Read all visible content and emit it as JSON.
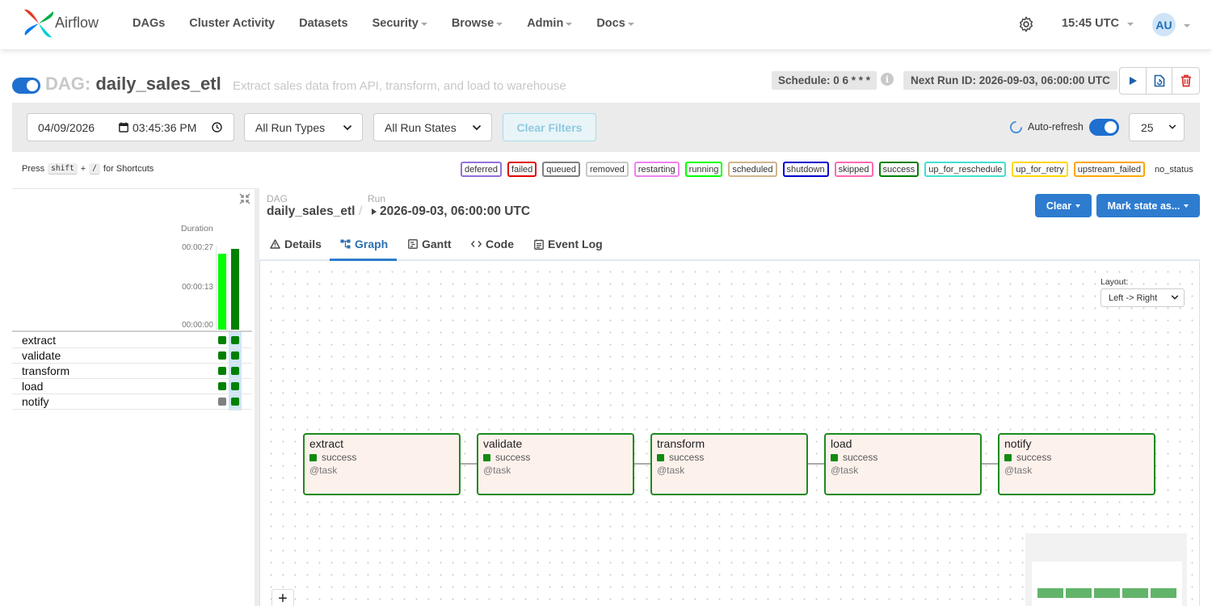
{
  "nav": {
    "brand": "Airflow",
    "items": [
      {
        "label": "DAGs",
        "dropdown": false
      },
      {
        "label": "Cluster Activity",
        "dropdown": false
      },
      {
        "label": "Datasets",
        "dropdown": false
      },
      {
        "label": "Security",
        "dropdown": true
      },
      {
        "label": "Browse",
        "dropdown": true
      },
      {
        "label": "Admin",
        "dropdown": true
      },
      {
        "label": "Docs",
        "dropdown": true
      }
    ],
    "time": "15:45 UTC",
    "user_initials": "AU"
  },
  "dag": {
    "prefix": "DAG:",
    "id": "daily_sales_etl",
    "description": "Extract sales data from API, transform, and load to warehouse",
    "schedule": "Schedule: 0 6 * * *",
    "next_run": "Next Run ID: 2026-09-03, 06:00:00 UTC"
  },
  "filters": {
    "date": "04/09/2026",
    "time": "03:45:36 PM",
    "run_type": "All Run Types",
    "run_state": "All Run States",
    "clear_filters": "Clear Filters",
    "auto_refresh": "Auto-refresh",
    "count": "25"
  },
  "shortcuts": {
    "press": "Press",
    "key1": "shift",
    "plus": "+",
    "key2": "/",
    "suffix": "for Shortcuts"
  },
  "legend": [
    {
      "label": "deferred",
      "color": "#9370db"
    },
    {
      "label": "failed",
      "color": "#e00000"
    },
    {
      "label": "queued",
      "color": "#808080"
    },
    {
      "label": "removed",
      "color": "#c8c8c8"
    },
    {
      "label": "restarting",
      "color": "#ee82ee"
    },
    {
      "label": "running",
      "color": "#00ff00"
    },
    {
      "label": "scheduled",
      "color": "#d2b48c"
    },
    {
      "label": "shutdown",
      "color": "#0000cd"
    },
    {
      "label": "skipped",
      "color": "#ff69b4"
    },
    {
      "label": "success",
      "color": "#008000"
    },
    {
      "label": "up_for_reschedule",
      "color": "#40e0d0"
    },
    {
      "label": "up_for_retry",
      "color": "#ffd700"
    },
    {
      "label": "upstream_failed",
      "color": "#ffa500"
    },
    {
      "label": "no_status",
      "color": ""
    }
  ],
  "grid": {
    "duration_label": "Duration",
    "ticks": [
      "00:00:27",
      "00:00:13",
      "00:00:00"
    ],
    "runs": [
      {
        "duration_fraction": 0.92,
        "color": "#00ff00"
      },
      {
        "duration_fraction": 0.98,
        "color": "#008000"
      }
    ],
    "tasks": [
      {
        "name": "extract",
        "states": [
          "#008000",
          "#008000"
        ]
      },
      {
        "name": "validate",
        "states": [
          "#008000",
          "#008000"
        ]
      },
      {
        "name": "transform",
        "states": [
          "#008000",
          "#008000"
        ]
      },
      {
        "name": "load",
        "states": [
          "#008000",
          "#008000"
        ]
      },
      {
        "name": "notify",
        "states": [
          "#808080",
          "#008000"
        ]
      }
    ]
  },
  "details": {
    "dag_label": "DAG",
    "dag_value": "daily_sales_etl",
    "slash": "/",
    "run_label": "Run",
    "run_value": "2026-09-03, 06:00:00 UTC",
    "clear_btn": "Clear",
    "mark_btn": "Mark state as...",
    "tabs": [
      "Details",
      "Graph",
      "Gantt",
      "Code",
      "Event Log"
    ],
    "active_tab": "Graph"
  },
  "graph": {
    "layout_label": "Layout:",
    "layout_value": "Left -> Right",
    "nodes": [
      {
        "name": "extract",
        "state": "success",
        "operator": "@task"
      },
      {
        "name": "validate",
        "state": "success",
        "operator": "@task"
      },
      {
        "name": "transform",
        "state": "success",
        "operator": "@task"
      },
      {
        "name": "load",
        "state": "success",
        "operator": "@task"
      },
      {
        "name": "notify",
        "state": "success",
        "operator": "@task"
      }
    ],
    "zoom_in": "+"
  }
}
